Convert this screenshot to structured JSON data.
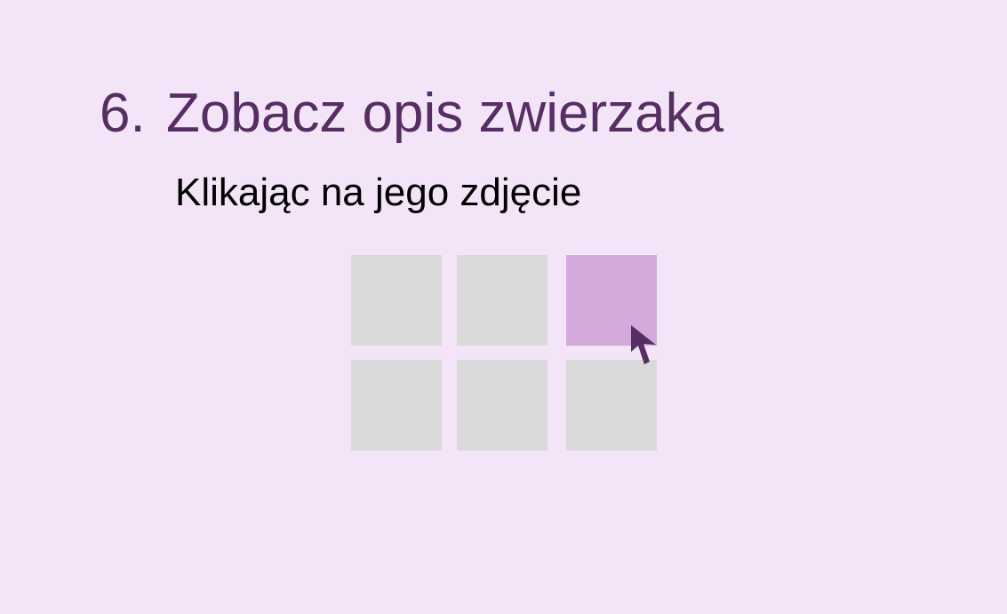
{
  "step": {
    "number": "6.",
    "title": "Zobacz opis zwierzaka",
    "subtitle": "Klikając na jego zdjęcie"
  },
  "grid": {
    "tiles": [
      {
        "selected": false
      },
      {
        "selected": false
      },
      {
        "selected": true
      },
      {
        "selected": false
      },
      {
        "selected": false
      },
      {
        "selected": false
      }
    ]
  },
  "colors": {
    "background": "#f3e5f7",
    "heading": "#572e63",
    "tile": "#d9d9d9",
    "tile_selected": "#d4a9dc",
    "cursor": "#572e63"
  },
  "icons": {
    "cursor": "mouse-pointer-icon"
  }
}
